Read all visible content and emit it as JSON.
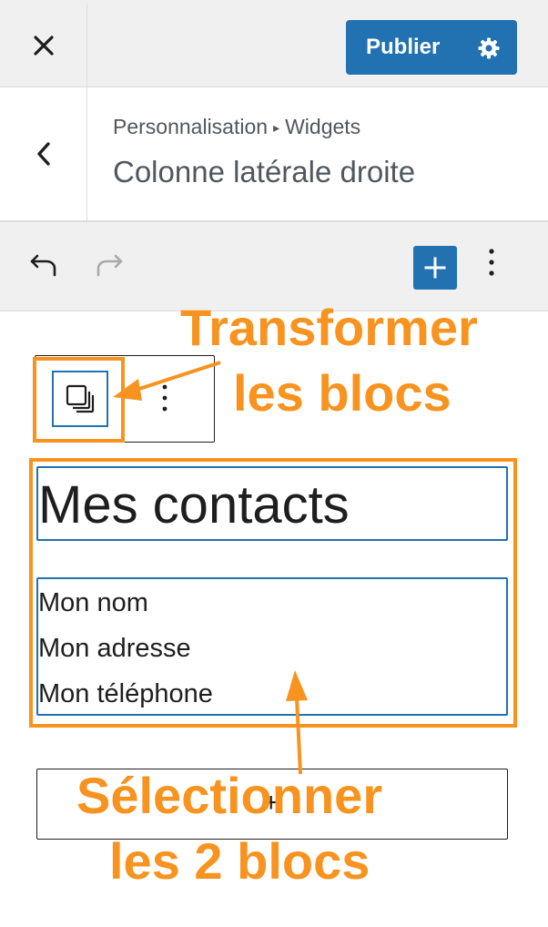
{
  "topbar": {
    "publish_label": "Publier"
  },
  "header": {
    "breadcrumb": {
      "parent": "Personnalisation",
      "separator": "▸",
      "current": "Widgets"
    },
    "title": "Colonne latérale droite"
  },
  "toolbar": {
    "undo": "undo-icon",
    "redo": "redo-icon",
    "add": "plus-icon",
    "more": "more-vertical-icon"
  },
  "block_toolbar": {
    "transform": "transform-blocks-icon",
    "options": "more-vertical-icon"
  },
  "content": {
    "heading": "Mes contacts",
    "paragraph_lines": [
      "Mon nom",
      "Mon adresse",
      "Mon téléphone"
    ],
    "appender_symbol": "+"
  },
  "annotations": {
    "transform": [
      "Transformer",
      "les blocs"
    ],
    "select": [
      "Sélectionner",
      "les 2 blocs"
    ]
  },
  "colors": {
    "accent": "#2271b1",
    "annotation": "#f7931e",
    "chrome": "#f0f0f1"
  }
}
